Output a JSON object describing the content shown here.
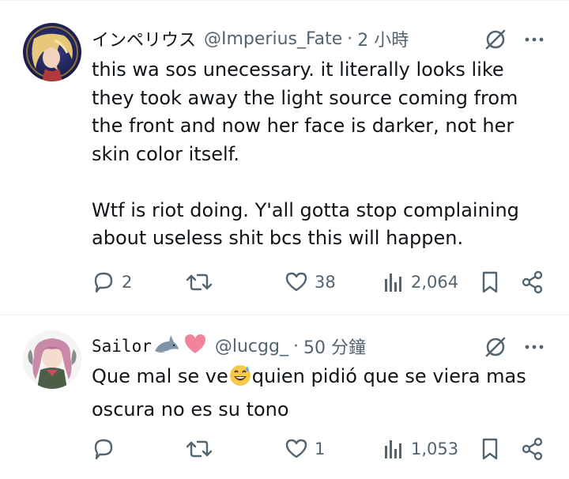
{
  "tweets": [
    {
      "display_name": "インペリウス",
      "handle": "@Imperius_Fate",
      "separator": "·",
      "time": "2 小時",
      "text": "this wa sos unecessary. it literally looks like they took away the light source coming from the front and now her face is darker, not her skin color itself.\n\nWtf is riot doing. Y'all gotta stop complaining about useless shit bcs this will happen.",
      "replies": "2",
      "retweets": "",
      "likes": "38",
      "views": "2,064"
    },
    {
      "display_name": "Sailor",
      "handle": "@lucgg_",
      "separator": "·",
      "time": "50 分鐘",
      "text_before_emoji": "Que mal se ve",
      "text_after_emoji": "quien pidió que se viera mas oscura no es su tono",
      "replies": "",
      "retweets": "",
      "likes": "1",
      "views": "1,053"
    }
  ],
  "icons": {
    "reply": "speech-bubble-icon",
    "retweet": "retweet-arrows-icon",
    "like": "heart-outline-icon",
    "views": "bar-chart-icon",
    "bookmark": "bookmark-icon",
    "share": "share-icon",
    "grok": "grok-slash-circle-icon",
    "more": "more-dots-icon"
  },
  "colors": {
    "text": "#0f1419",
    "secondary": "#536471",
    "divider": "#eff3f4",
    "heart_emoji": "#f0849a"
  }
}
